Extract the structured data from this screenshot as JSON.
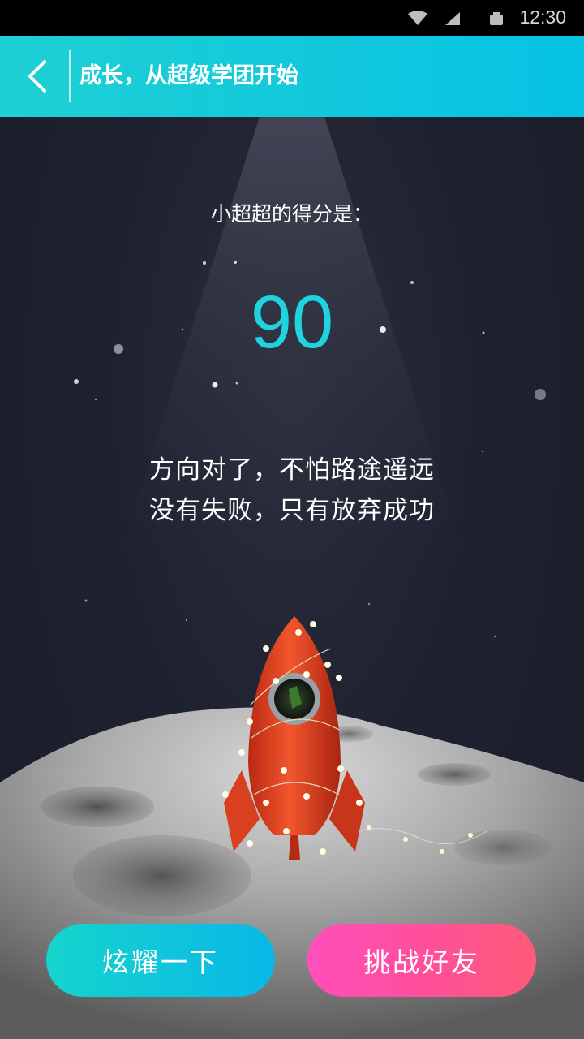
{
  "status_bar": {
    "time": "12:30",
    "icons": [
      "wifi-icon",
      "signal-icon",
      "battery-icon"
    ]
  },
  "app_bar": {
    "back_icon": "chevron-left-icon",
    "title": "成长，从超级学团开始",
    "background": "#13c9dc"
  },
  "result": {
    "label": "小超超的得分是：",
    "score": "90",
    "score_color": "#1fd3df"
  },
  "motto": {
    "line1": "方向对了，不怕路途遥远",
    "line2": "没有失败，只有放弃成功"
  },
  "buttons": {
    "show_off": "炫耀一下",
    "challenge": "挑战好友"
  }
}
